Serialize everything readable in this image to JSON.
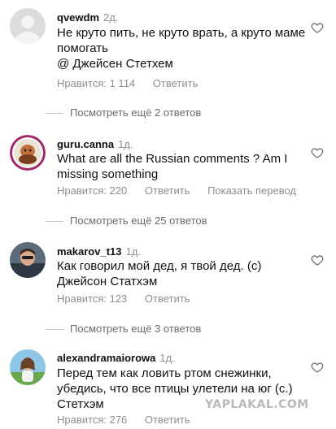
{
  "comments": [
    {
      "username": "qvewdm",
      "time": "2д.",
      "text_line1": "Не круто пить, не круто врать, а круто маме",
      "text_line2": "помогать",
      "text_line3": "@ Джейсен Стетхем",
      "likes": "Нравится: 1 114",
      "reply": "Ответить",
      "avatar_icon": "default-avatar-icon"
    },
    {
      "username": "guru.canna",
      "time": "1д.",
      "text_line1": "What are all the Russian comments ? Am I",
      "text_line2": "missing something",
      "likes": "Нравится: 220",
      "reply": "Ответить",
      "translate": "Показать перевод",
      "avatar_icon": "profile-photo-icon"
    },
    {
      "username": "makarov_t13",
      "time": "1д.",
      "text_line1": "Как говорил мой дед, я твой дед. (с)",
      "text_line2": "Джейсон Статхэм",
      "likes": "Нравится: 123",
      "reply": "Ответить",
      "avatar_icon": "profile-photo-icon"
    },
    {
      "username": "alexandramaiorowa",
      "time": "1д.",
      "text_line1": "Перед тем как ловить ртом снежинки,",
      "text_line2": "убедись, что все птицы улетели на юг (с.)",
      "text_line3": "Стетхэм",
      "likes": "Нравится: 276",
      "reply": "Ответить",
      "avatar_icon": "profile-photo-icon"
    }
  ],
  "view_more": [
    "Посмотреть ещё 2 ответов",
    "Посмотреть ещё 25 ответов",
    "Посмотреть ещё 3 ответов"
  ],
  "watermark": "YAPLAKAL.COM",
  "colors": {
    "meta_text": "#8e8e8e",
    "divider": "#c7c7c7"
  }
}
